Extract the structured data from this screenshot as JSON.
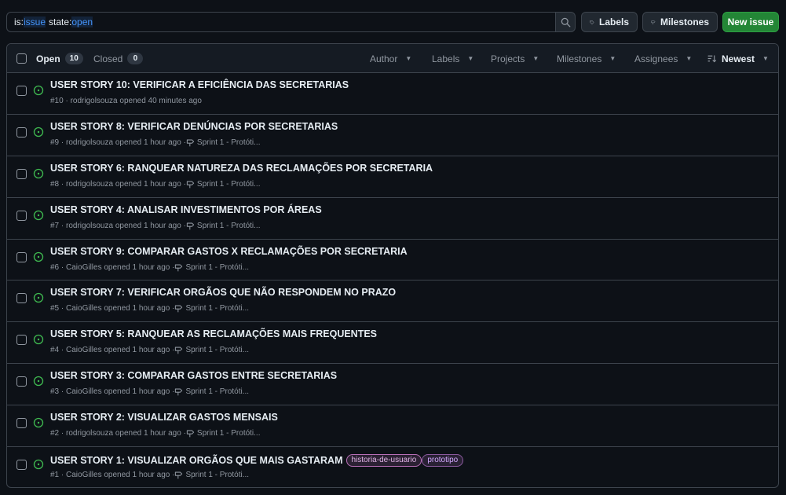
{
  "search": {
    "tokens": [
      {
        "key": "is:",
        "value": "issue"
      },
      {
        "key": "state:",
        "value": "open"
      }
    ]
  },
  "toolbar": {
    "labels_label": "Labels",
    "milestones_label": "Milestones",
    "new_issue_label": "New issue"
  },
  "header": {
    "open_label": "Open",
    "open_count": "10",
    "closed_label": "Closed",
    "closed_count": "0",
    "filters": {
      "author": "Author",
      "labels": "Labels",
      "projects": "Projects",
      "milestones": "Milestones",
      "assignees": "Assignees",
      "sort": "Newest"
    }
  },
  "colors": {
    "open_icon": "#3fb950",
    "accent_green": "#238636",
    "link_blue": "#4493f8"
  },
  "issues": [
    {
      "title": "USER STORY 10: VERIFICAR A EFICIÊNCIA DAS SECRETARIAS",
      "meta": "#10 · rodrigolsouza opened 40 minutes ago",
      "milestone": "",
      "labels": []
    },
    {
      "title": "USER STORY 8: VERIFICAR DENÚNCIAS POR SECRETARIAS",
      "meta": "#9 · rodrigolsouza opened 1 hour ago ·",
      "milestone": "Sprint 1 - Protóti...",
      "labels": []
    },
    {
      "title": "USER STORY 6: RANQUEAR NATUREZA DAS RECLAMAÇÕES POR SECRETARIA",
      "meta": "#8 · rodrigolsouza opened 1 hour ago ·",
      "milestone": "Sprint 1 - Protóti...",
      "labels": []
    },
    {
      "title": "USER STORY 4: ANALISAR INVESTIMENTOS POR ÁREAS",
      "meta": "#7 · rodrigolsouza opened 1 hour ago ·",
      "milestone": "Sprint 1 - Protóti...",
      "labels": []
    },
    {
      "title": "USER STORY 9: COMPARAR GASTOS X RECLAMAÇÕES POR SECRETARIA",
      "meta": "#6 · CaioGilles opened 1 hour ago ·",
      "milestone": "Sprint 1 - Protóti...",
      "labels": []
    },
    {
      "title": "USER STORY 7: VERIFICAR ORGÃOS QUE NÃO RESPONDEM NO PRAZO",
      "meta": "#5 · CaioGilles opened 1 hour ago ·",
      "milestone": "Sprint 1 - Protóti...",
      "labels": []
    },
    {
      "title": "USER STORY 5: RANQUEAR AS RECLAMAÇÕES MAIS FREQUENTES",
      "meta": "#4 · CaioGilles opened 1 hour ago ·",
      "milestone": "Sprint 1 - Protóti...",
      "labels": []
    },
    {
      "title": "USER STORY 3: COMPARAR GASTOS ENTRE SECRETARIAS",
      "meta": "#3 · CaioGilles opened 1 hour ago ·",
      "milestone": "Sprint 1 - Protóti...",
      "labels": []
    },
    {
      "title": "USER STORY 2: VISUALIZAR GASTOS MENSAIS",
      "meta": "#2 · rodrigolsouza opened 1 hour ago ·",
      "milestone": "Sprint 1 - Protóti...",
      "labels": []
    },
    {
      "title": "USER STORY 1: VISUALIZAR ORGÃOS QUE MAIS GASTARAM",
      "meta": "#1 · CaioGilles opened 1 hour ago ·",
      "milestone": "Sprint 1 - Protóti...",
      "labels": [
        "historia-de-usuario",
        "prototipo"
      ]
    }
  ]
}
